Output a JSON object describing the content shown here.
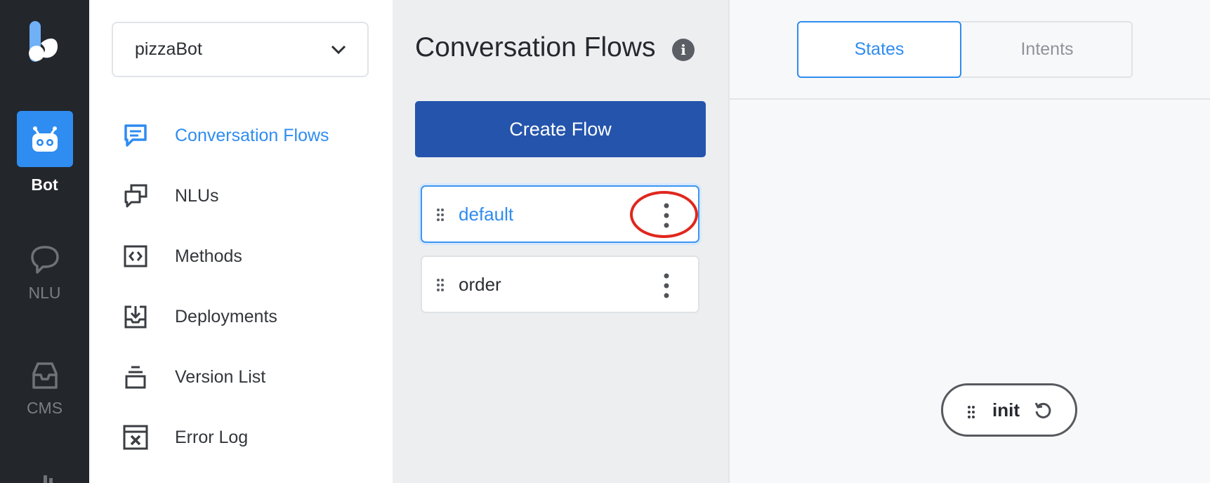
{
  "rail": {
    "items": [
      {
        "label": "Bot",
        "icon": "robot-icon",
        "active": true
      },
      {
        "label": "NLU",
        "icon": "chat-bubble-icon",
        "active": false
      },
      {
        "label": "CMS",
        "icon": "inbox-icon",
        "active": false
      }
    ]
  },
  "sidenav": {
    "bot_selector": {
      "value": "pizzaBot"
    },
    "items": [
      {
        "label": "Conversation Flows",
        "icon": "message-square-icon",
        "active": true
      },
      {
        "label": "NLUs",
        "icon": "stacked-chats-icon",
        "active": false
      },
      {
        "label": "Methods",
        "icon": "code-brackets-icon",
        "active": false
      },
      {
        "label": "Deployments",
        "icon": "download-tray-icon",
        "active": false
      },
      {
        "label": "Version List",
        "icon": "stack-icon",
        "active": false
      },
      {
        "label": "Error Log",
        "icon": "error-window-icon",
        "active": false
      }
    ]
  },
  "flows": {
    "title": "Conversation Flows",
    "create_label": "Create Flow",
    "list": [
      {
        "name": "default",
        "selected": true
      },
      {
        "name": "order",
        "selected": false
      }
    ]
  },
  "canvas": {
    "tabs": [
      {
        "label": "States",
        "active": true
      },
      {
        "label": "Intents",
        "active": false
      }
    ],
    "node": {
      "label": "init"
    }
  },
  "colors": {
    "accent": "#2f8cf0",
    "primary_button": "#2454ac",
    "rail_bg": "#23262b",
    "highlight": "#e0271e"
  }
}
